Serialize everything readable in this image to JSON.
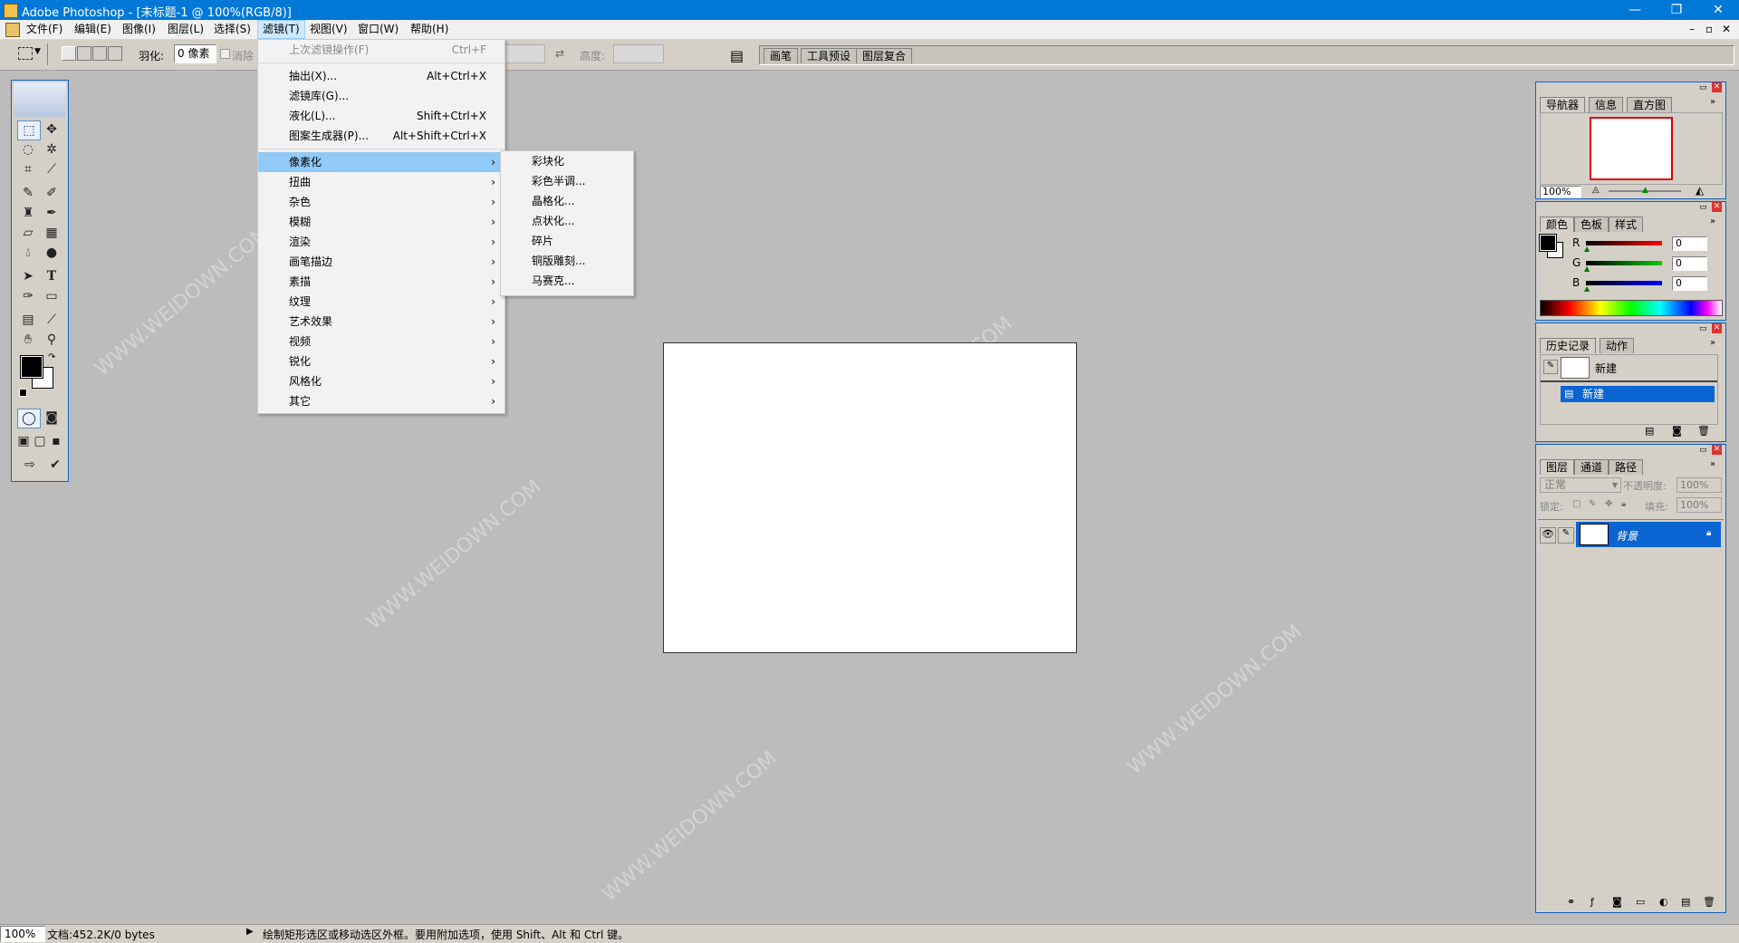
{
  "window": {
    "title": "Adobe Photoshop - [未标题-1 @ 100%(RGB/8)]",
    "minimize": "—",
    "restore": "❐",
    "close": "✕"
  },
  "menubar": {
    "items": [
      "文件(F)",
      "编辑(E)",
      "图像(I)",
      "图层(L)",
      "选择(S)",
      "滤镜(T)",
      "视图(V)",
      "窗口(W)",
      "帮助(H)"
    ],
    "active_index": 5,
    "mdi_min": "–",
    "mdi_restore": "▫",
    "mdi_close": "✕"
  },
  "options": {
    "feather_label": "羽化:",
    "feather_value": "0 像素",
    "antialias_label": "消除锯齿",
    "height_label": "高度:",
    "well_tabs": [
      "画笔",
      "工具预设",
      "图层复合"
    ]
  },
  "filter_menu": {
    "items": [
      {
        "label": "上次滤镜操作(F)",
        "shortcut": "Ctrl+F",
        "disabled": true
      },
      {
        "sep": true
      },
      {
        "label": "抽出(X)...",
        "shortcut": "Alt+Ctrl+X"
      },
      {
        "label": "滤镜库(G)...",
        "shortcut": ""
      },
      {
        "label": "液化(L)...",
        "shortcut": "Shift+Ctrl+X"
      },
      {
        "label": "图案生成器(P)...",
        "shortcut": "Alt+Shift+Ctrl+X"
      },
      {
        "sep": true
      },
      {
        "label": "像素化",
        "submenu": true,
        "highlighted": true
      },
      {
        "label": "扭曲",
        "submenu": true
      },
      {
        "label": "杂色",
        "submenu": true
      },
      {
        "label": "模糊",
        "submenu": true
      },
      {
        "label": "渲染",
        "submenu": true
      },
      {
        "label": "画笔描边",
        "submenu": true
      },
      {
        "label": "素描",
        "submenu": true
      },
      {
        "label": "纹理",
        "submenu": true
      },
      {
        "label": "艺术效果",
        "submenu": true
      },
      {
        "label": "视频",
        "submenu": true
      },
      {
        "label": "锐化",
        "submenu": true
      },
      {
        "label": "风格化",
        "submenu": true
      },
      {
        "label": "其它",
        "submenu": true
      }
    ]
  },
  "pixelate_submenu": {
    "items": [
      "彩块化",
      "彩色半调...",
      "晶格化...",
      "点状化...",
      "碎片",
      "铜版雕刻...",
      "马赛克..."
    ]
  },
  "navigator_panel": {
    "tabs": [
      "导航器",
      "信息",
      "直方图"
    ],
    "zoom": "100%"
  },
  "color_panel": {
    "tabs": [
      "颜色",
      "色板",
      "样式"
    ],
    "channels": [
      {
        "name": "R",
        "value": "0",
        "color": "#ff0000"
      },
      {
        "name": "G",
        "value": "0",
        "color": "#00cc00"
      },
      {
        "name": "B",
        "value": "0",
        "color": "#0000ff"
      }
    ]
  },
  "history_panel": {
    "tabs": [
      "历史记录",
      "动作"
    ],
    "snapshot": "新建",
    "states": [
      "新建"
    ]
  },
  "layers_panel": {
    "tabs": [
      "图层",
      "通道",
      "路径"
    ],
    "blend_mode": "正常",
    "opacity_label": "不透明度:",
    "opacity": "100%",
    "lock_label": "锁定:",
    "fill_label": "填充:",
    "fill": "100%",
    "layers": [
      {
        "name": "背景",
        "locked": true
      }
    ]
  },
  "status": {
    "zoom": "100%",
    "doc": "文档:452.2K/0 bytes",
    "hint": "绘制矩形选区或移动选区外框。要用附加选项，使用 Shift、Alt 和 Ctrl 键。"
  },
  "colors": {
    "accent": "#0078d7",
    "menu_highlight": "#91c9f7",
    "workspace": "#bcbcbc",
    "panel_bg": "#d4d0c8"
  }
}
